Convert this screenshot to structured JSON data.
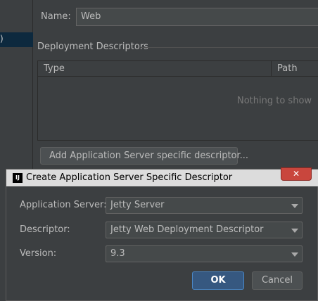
{
  "left_panel": {
    "selected_item_text": ")"
  },
  "name_field": {
    "label": "Name:",
    "value": "Web"
  },
  "deployment_descriptors": {
    "section_title": "Deployment Descriptors",
    "columns": [
      "Type",
      "Path"
    ],
    "empty_text": "Nothing to show",
    "add_button_label": "Add Application Server specific descriptor..."
  },
  "dialog": {
    "title": "Create Application Server Specific Descriptor",
    "app_icon": "intellij-icon",
    "close_icon": "close-icon",
    "application_server": {
      "label": "Application Server:",
      "value": "Jetty Server"
    },
    "descriptor": {
      "label": "Descriptor:",
      "value": "Jetty Web Deployment Descriptor"
    },
    "version": {
      "label": "Version:",
      "value": "9.3"
    },
    "ok_label": "OK",
    "cancel_label": "Cancel"
  },
  "colors": {
    "background": "#3c3f41",
    "input_bg": "#45494a",
    "selection": "#0d293e",
    "ok_button": "#365880",
    "close_button": "#c9463d"
  }
}
